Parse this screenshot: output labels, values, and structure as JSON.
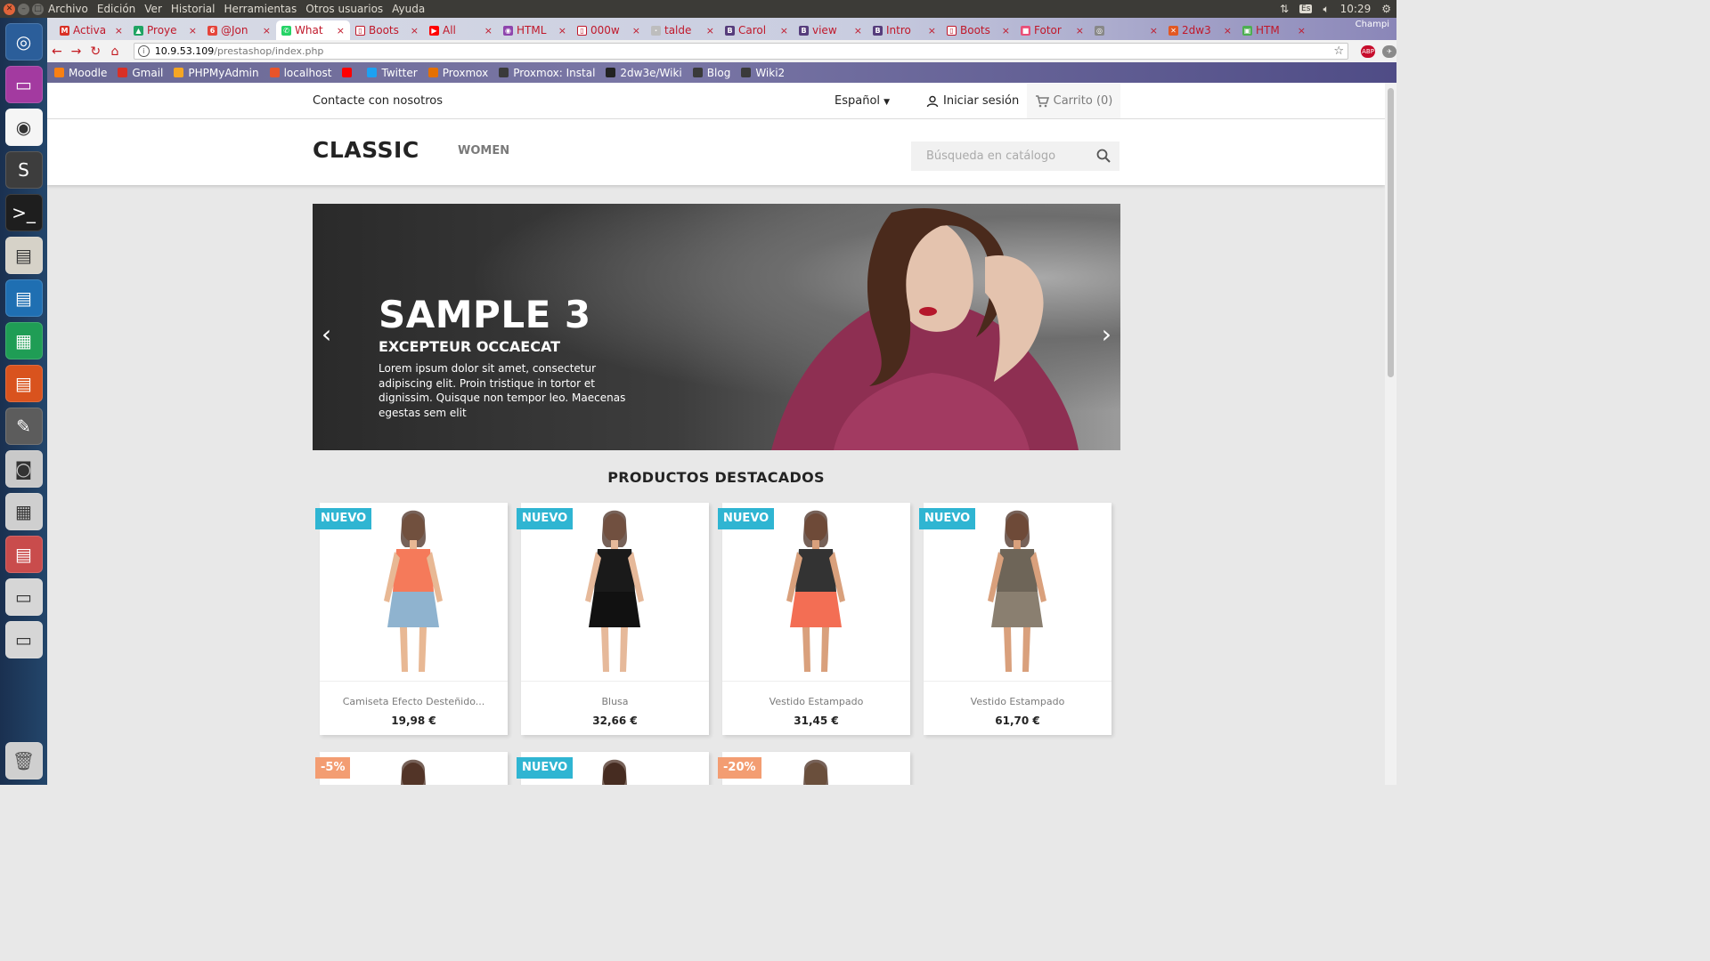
{
  "ubuntu_panel": {
    "menus": [
      "Archivo",
      "Edición",
      "Ver",
      "Historial",
      "Herramientas",
      "Otros usuarios",
      "Ayuda"
    ],
    "keyboard": "Es",
    "clock": "10:29"
  },
  "launcher": {
    "apps": [
      "dash-icon",
      "workspace-icon",
      "chrome-icon",
      "sublime-icon",
      "terminal-icon",
      "files-icon",
      "writer-icon",
      "calc-icon",
      "impress-icon",
      "settings-icon",
      "camera-icon",
      "calculator-icon",
      "files-icon-2",
      "drive-icon",
      "drive-icon-2"
    ],
    "trash": "trash-icon"
  },
  "browser": {
    "tabs": [
      {
        "title": "Activa",
        "color": "#d93025",
        "glyph": "M"
      },
      {
        "title": "Proye",
        "color": "#1fa463",
        "glyph": "▲"
      },
      {
        "title": "@Jon",
        "color": "#e5453b",
        "glyph": "6"
      },
      {
        "title": "What",
        "color": "#25d366",
        "glyph": "✆"
      },
      {
        "title": "Boots",
        "color": "#ffffff",
        "glyph": "▯"
      },
      {
        "title": "All",
        "color": "#ff0000",
        "glyph": "▶"
      },
      {
        "title": "HTML",
        "color": "#8e44ad",
        "glyph": "◉"
      },
      {
        "title": "000w",
        "color": "#ffffff",
        "glyph": "▯"
      },
      {
        "title": "talde",
        "color": "#bdbdbd",
        "glyph": "·"
      },
      {
        "title": "Carol",
        "color": "#563d7c",
        "glyph": "B"
      },
      {
        "title": "view",
        "color": "#563d7c",
        "glyph": "B"
      },
      {
        "title": "Intro",
        "color": "#563d7c",
        "glyph": "B"
      },
      {
        "title": "Boots",
        "color": "#ffffff",
        "glyph": "▯"
      },
      {
        "title": "Fotor",
        "color": "#e94e77",
        "glyph": "■"
      },
      {
        "title": "",
        "color": "#888888",
        "glyph": "◎"
      },
      {
        "title": "2dw3",
        "color": "#e25822",
        "glyph": "✕"
      },
      {
        "title": "HTM",
        "color": "#4caf50",
        "glyph": "▣"
      }
    ],
    "user": "Champi",
    "url_host": "10.9.53.109",
    "url_path": "/prestashop/index.php",
    "bookmarks": [
      {
        "label": "Moodle",
        "color": "#f98012"
      },
      {
        "label": "Gmail",
        "color": "#d93025"
      },
      {
        "label": "PHPMyAdmin",
        "color": "#f5a623"
      },
      {
        "label": "localhost",
        "color": "#e8542a"
      },
      {
        "label": "",
        "color": "#ff0000"
      },
      {
        "label": "Twitter",
        "color": "#1da1f2"
      },
      {
        "label": "Proxmox",
        "color": "#e57000"
      },
      {
        "label": "Proxmox: Instal",
        "color": "#3a3a3a"
      },
      {
        "label": "2dw3e/Wiki",
        "color": "#222222"
      },
      {
        "label": "Blog",
        "color": "#3a3a3a"
      },
      {
        "label": "Wiki2",
        "color": "#3a3a3a"
      }
    ]
  },
  "shop": {
    "nav": {
      "contact": "Contacte con nosotros",
      "language": "Español",
      "login": "Iniciar sesión",
      "cart": "Carrito (0)"
    },
    "logo": "CLASSIC",
    "menu": [
      "WOMEN"
    ],
    "search_placeholder": "Búsqueda en catálogo",
    "slide": {
      "title": "SAMPLE 3",
      "subtitle": "EXCEPTEUR OCCAECAT",
      "text": "Lorem ipsum dolor sit amet, consectetur adipiscing elit. Proin tristique in tortor et dignissim. Quisque non tempor leo. Maecenas egestas sem elit"
    },
    "featured_title": "PRODUCTOS DESTACADOS",
    "products": [
      {
        "name": "Camiseta Efecto Desteñido...",
        "price": "19,98 €",
        "badge": "NUEVO",
        "badge_type": "new",
        "top": "#f57a5a",
        "bottom": "#8fb3cf",
        "skin": "#e8b894"
      },
      {
        "name": "Blusa",
        "price": "32,66 €",
        "badge": "NUEVO",
        "badge_type": "new",
        "top": "#1a1a1a",
        "bottom": "#111111",
        "skin": "#e6b99a"
      },
      {
        "name": "Vestido Estampado",
        "price": "31,45 €",
        "badge": "NUEVO",
        "badge_type": "new",
        "top": "#333333",
        "bottom": "#f36e54",
        "skin": "#d9a07c"
      },
      {
        "name": "Vestido Estampado",
        "price": "61,70 €",
        "badge": "NUEVO",
        "badge_type": "new",
        "top": "#6e6558",
        "bottom": "#8a7f70",
        "skin": "#d9a07c"
      },
      {
        "name": "",
        "price": "",
        "badge": "-5%",
        "badge_type": "disc",
        "top": "#ffffff",
        "bottom": "#ffffff",
        "skin": "#6b4a3a"
      },
      {
        "name": "",
        "price": "",
        "badge": "NUEVO",
        "badge_type": "new",
        "top": "#ffffff",
        "bottom": "#ffffff",
        "skin": "#3d2a22"
      },
      {
        "name": "",
        "price": "",
        "badge": "-20%",
        "badge_type": "disc",
        "top": "#ffffff",
        "bottom": "#ffffff",
        "skin": "#c9b38a"
      }
    ]
  }
}
